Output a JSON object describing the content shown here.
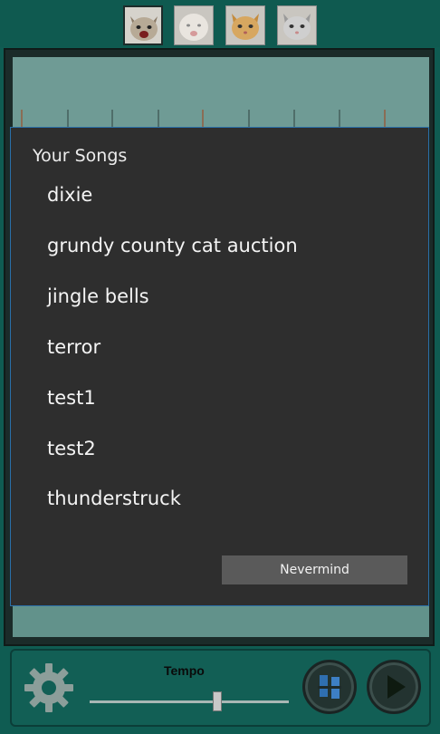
{
  "cats": [
    {
      "name": "cat-1",
      "selected": true
    },
    {
      "name": "cat-2",
      "selected": false
    },
    {
      "name": "cat-3",
      "selected": false
    },
    {
      "name": "cat-4",
      "selected": false
    }
  ],
  "dialog": {
    "title": "Your Songs",
    "songs": [
      "dixie",
      "grundy county cat auction",
      "jingle bells",
      "terror",
      "test1",
      "test2",
      "thunderstruck"
    ],
    "nevermind_label": "Nevermind"
  },
  "controls": {
    "tempo_label": "Tempo",
    "tempo_level": 0.64,
    "icons": [
      "gear-icon",
      "shuffle-icon",
      "play-icon"
    ]
  },
  "colors": {
    "background": "#0f5c52",
    "dialog_bg": "#2e2e2e",
    "dialog_border": "#2a6fa8",
    "staff": "#62928b"
  }
}
